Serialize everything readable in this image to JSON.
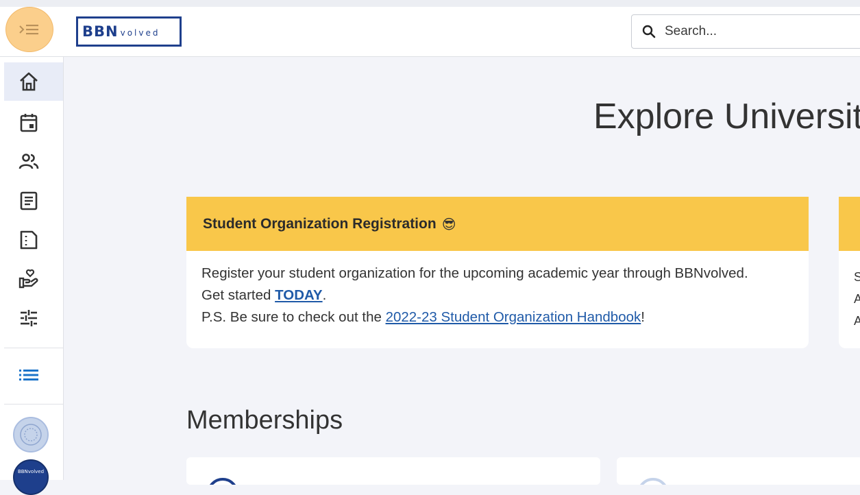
{
  "header": {
    "logo_main": "BBN",
    "logo_sub": "volved",
    "search_placeholder": "Search..."
  },
  "sidebar": {
    "items": [
      {
        "name": "home",
        "icon": "home-icon",
        "active": true
      },
      {
        "name": "events",
        "icon": "calendar-icon"
      },
      {
        "name": "organizations",
        "icon": "people-icon"
      },
      {
        "name": "news",
        "icon": "article-icon"
      },
      {
        "name": "forms",
        "icon": "document-icon"
      },
      {
        "name": "service",
        "icon": "hand-heart-icon"
      },
      {
        "name": "settings",
        "icon": "sliders-icon"
      }
    ],
    "list_icon": "list-icon",
    "org_avatar_2_text": "BBNvolved"
  },
  "main": {
    "page_title": "Explore University",
    "card": {
      "title": "Student Organization Registration",
      "emoji": "😎",
      "line1": "Register your student organization for the upcoming academic year through BBNvolved.",
      "line2_prefix": "Get started ",
      "line2_link": "TODAY",
      "line2_suffix": ".",
      "line3_prefix": "P.S. Be sure to check out the ",
      "line3_link": "2022-23 Student Organization Handbook",
      "line3_suffix": "!"
    },
    "card2_lines": [
      "S",
      "A",
      "A"
    ],
    "memberships_title": "Memberships"
  },
  "colors": {
    "accent_navy": "#1e3f8c",
    "card_header_yellow": "#f9c74a",
    "menu_toggle_orange": "#fbcf8c",
    "link_blue": "#1f5aa8",
    "list_icon_blue": "#1a73c9"
  }
}
